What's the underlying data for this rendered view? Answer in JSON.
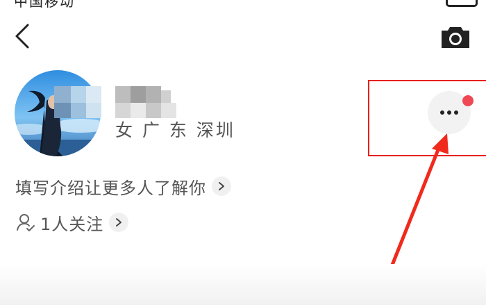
{
  "status_bar": {
    "text": "中国移动"
  },
  "header": {
    "back_icon": "chevron-left-icon",
    "camera_icon": "camera-icon"
  },
  "profile": {
    "location": "女 广 东 深圳",
    "intro": "填写介绍让更多人了解你",
    "follow": "1人关注"
  },
  "more": {
    "icon": "more-horizontal-icon",
    "badge_color": "#ef4a54"
  },
  "annotation": {
    "box_color": "#e8201e",
    "arrow_color": "#f02a1c"
  }
}
